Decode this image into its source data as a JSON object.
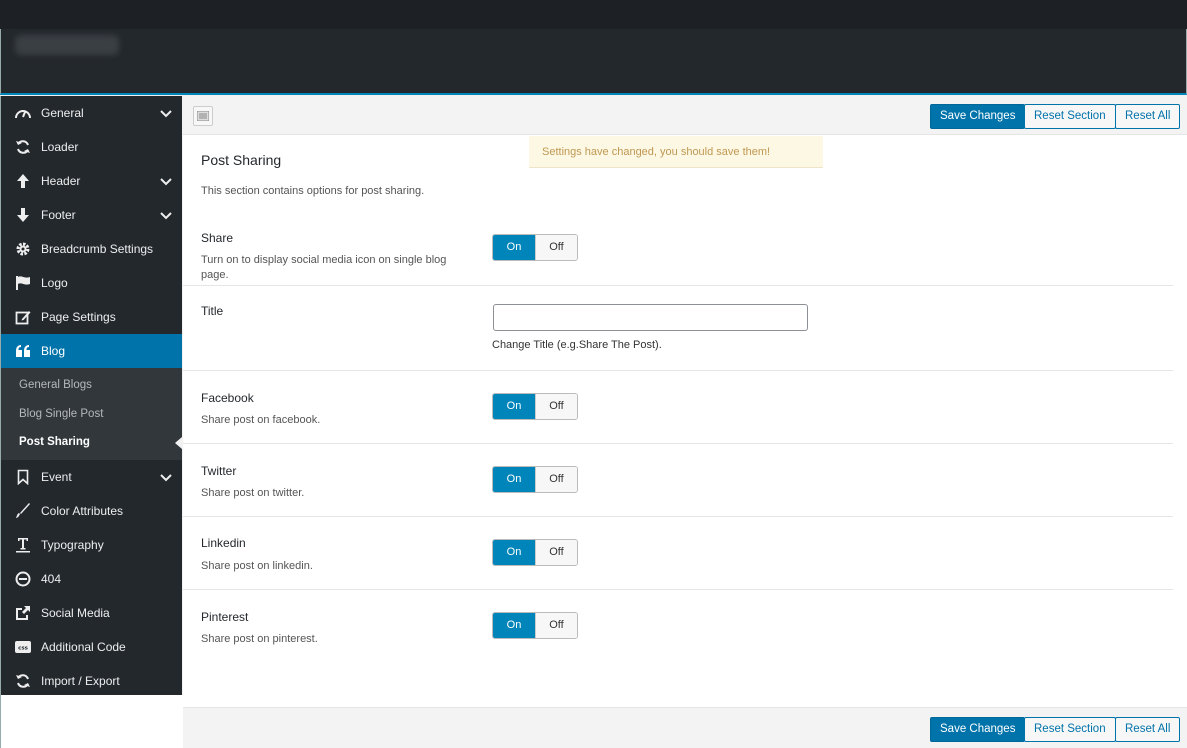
{
  "sidebar": {
    "items": [
      {
        "label": "General",
        "icon": "dashboard-icon",
        "chevron": true
      },
      {
        "label": "Loader",
        "icon": "refresh-icon"
      },
      {
        "label": "Header",
        "icon": "arrow-up-icon",
        "chevron": true
      },
      {
        "label": "Footer",
        "icon": "arrow-down-icon",
        "chevron": true
      },
      {
        "label": "Breadcrumb Settings",
        "icon": "gear-icon"
      },
      {
        "label": "Logo",
        "icon": "flag-icon"
      },
      {
        "label": "Page Settings",
        "icon": "edit-icon"
      },
      {
        "label": "Blog",
        "icon": "quote-icon",
        "active": true
      },
      {
        "label": "Event",
        "icon": "bookmark-icon",
        "chevron": true
      },
      {
        "label": "Color Attributes",
        "icon": "brush-icon"
      },
      {
        "label": "Typography",
        "icon": "text-icon"
      },
      {
        "label": "404",
        "icon": "minus-circle-icon"
      },
      {
        "label": "Social Media",
        "icon": "share-icon"
      },
      {
        "label": "Additional Code",
        "icon": "css-icon"
      },
      {
        "label": "Import / Export",
        "icon": "refresh-icon"
      }
    ],
    "blog_sub": [
      "General Blogs",
      "Blog Single Post",
      "Post Sharing"
    ]
  },
  "toolbar": {
    "save": "Save Changes",
    "reset_section": "Reset Section",
    "reset_all": "Reset All"
  },
  "notice": "Settings have changed, you should save them!",
  "section": {
    "title": "Post Sharing",
    "desc": "This section contains options for post sharing."
  },
  "fields": {
    "share": {
      "label": "Share",
      "desc": "Turn on to display social media icon on single blog page.",
      "value": "On"
    },
    "title": {
      "label": "Title",
      "value": "",
      "help": "Change Title (e.g.Share The Post)."
    },
    "facebook": {
      "label": "Facebook",
      "desc": "Share post on facebook.",
      "value": "On"
    },
    "twitter": {
      "label": "Twitter",
      "desc": "Share post on twitter.",
      "value": "On"
    },
    "linkedin": {
      "label": "Linkedin",
      "desc": "Share post on linkedin.",
      "value": "On"
    },
    "pinterest": {
      "label": "Pinterest",
      "desc": "Share post on pinterest.",
      "value": "On"
    }
  },
  "switch": {
    "on": "On",
    "off": "Off"
  },
  "colors": {
    "accent": "#0073aa",
    "sidebar": "#23282d",
    "notice": "#fcf8e3"
  }
}
